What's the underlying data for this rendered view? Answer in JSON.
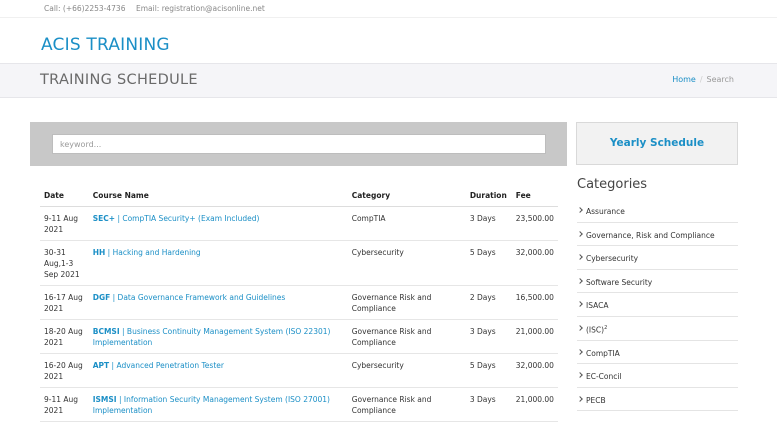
{
  "topbar": {
    "call": "Call: (+66)2253-4736",
    "email": "Email: registration@acisonline.net"
  },
  "brand": {
    "part1": "ACIS",
    "part2": "TRAINING"
  },
  "page": {
    "title": "TRAINING SCHEDULE"
  },
  "breadcrumb": {
    "home": "Home",
    "separator": "/",
    "current": "Search"
  },
  "search": {
    "placeholder": "keyword...",
    "value": ""
  },
  "yearly_button": "Yearly Schedule",
  "table": {
    "headers": {
      "date": "Date",
      "course": "Course Name",
      "category": "Category",
      "duration": "Duration",
      "fee": "Fee"
    },
    "rows": [
      {
        "date": "9-11 Aug 2021",
        "code": "SEC+",
        "name": "CompTIA Security+ (Exam Included)",
        "category": "CompTIA",
        "duration": "3 Days",
        "fee": "23,500.00"
      },
      {
        "date": "30-31 Aug,1-3 Sep 2021",
        "code": "HH",
        "name": "Hacking and Hardening",
        "category": "Cybersecurity",
        "duration": "5 Days",
        "fee": "32,000.00"
      },
      {
        "date": "16-17 Aug 2021",
        "code": "DGF",
        "name": "Data Governance Framework and Guidelines",
        "category": "Governance Risk and Compliance",
        "duration": "2 Days",
        "fee": "16,500.00"
      },
      {
        "date": "18-20 Aug 2021",
        "code": "BCMSI",
        "name": "Business Continuity Management System (ISO 22301) Implementation",
        "category": "Governance Risk and Compliance",
        "duration": "3 Days",
        "fee": "21,000.00"
      },
      {
        "date": "16-20 Aug 2021",
        "code": "APT",
        "name": "Advanced Penetration Tester",
        "category": "Cybersecurity",
        "duration": "5 Days",
        "fee": "32,000.00"
      },
      {
        "date": "9-11 Aug 2021",
        "code": "ISMSI",
        "name": "Information Security Management System (ISO 27001) Implementation",
        "category": "Governance Risk and Compliance",
        "duration": "3 Days",
        "fee": "21,000.00"
      }
    ]
  },
  "categories": {
    "title": "Categories",
    "items": [
      {
        "label": "Assurance",
        "sup": ""
      },
      {
        "label": "Governance, Risk and Compliance",
        "sup": ""
      },
      {
        "label": "Cybersecurity",
        "sup": ""
      },
      {
        "label": "Software Security",
        "sup": ""
      },
      {
        "label": "ISACA",
        "sup": ""
      },
      {
        "label": "(ISC)",
        "sup": "2"
      },
      {
        "label": "CompTIA",
        "sup": ""
      },
      {
        "label": "EC-Concil",
        "sup": ""
      },
      {
        "label": "PECB",
        "sup": ""
      }
    ]
  },
  "colors": {
    "accent": "#1b8fc6",
    "search_bg": "#c8c8c8",
    "titlebar_bg": "#f5f5f8"
  }
}
